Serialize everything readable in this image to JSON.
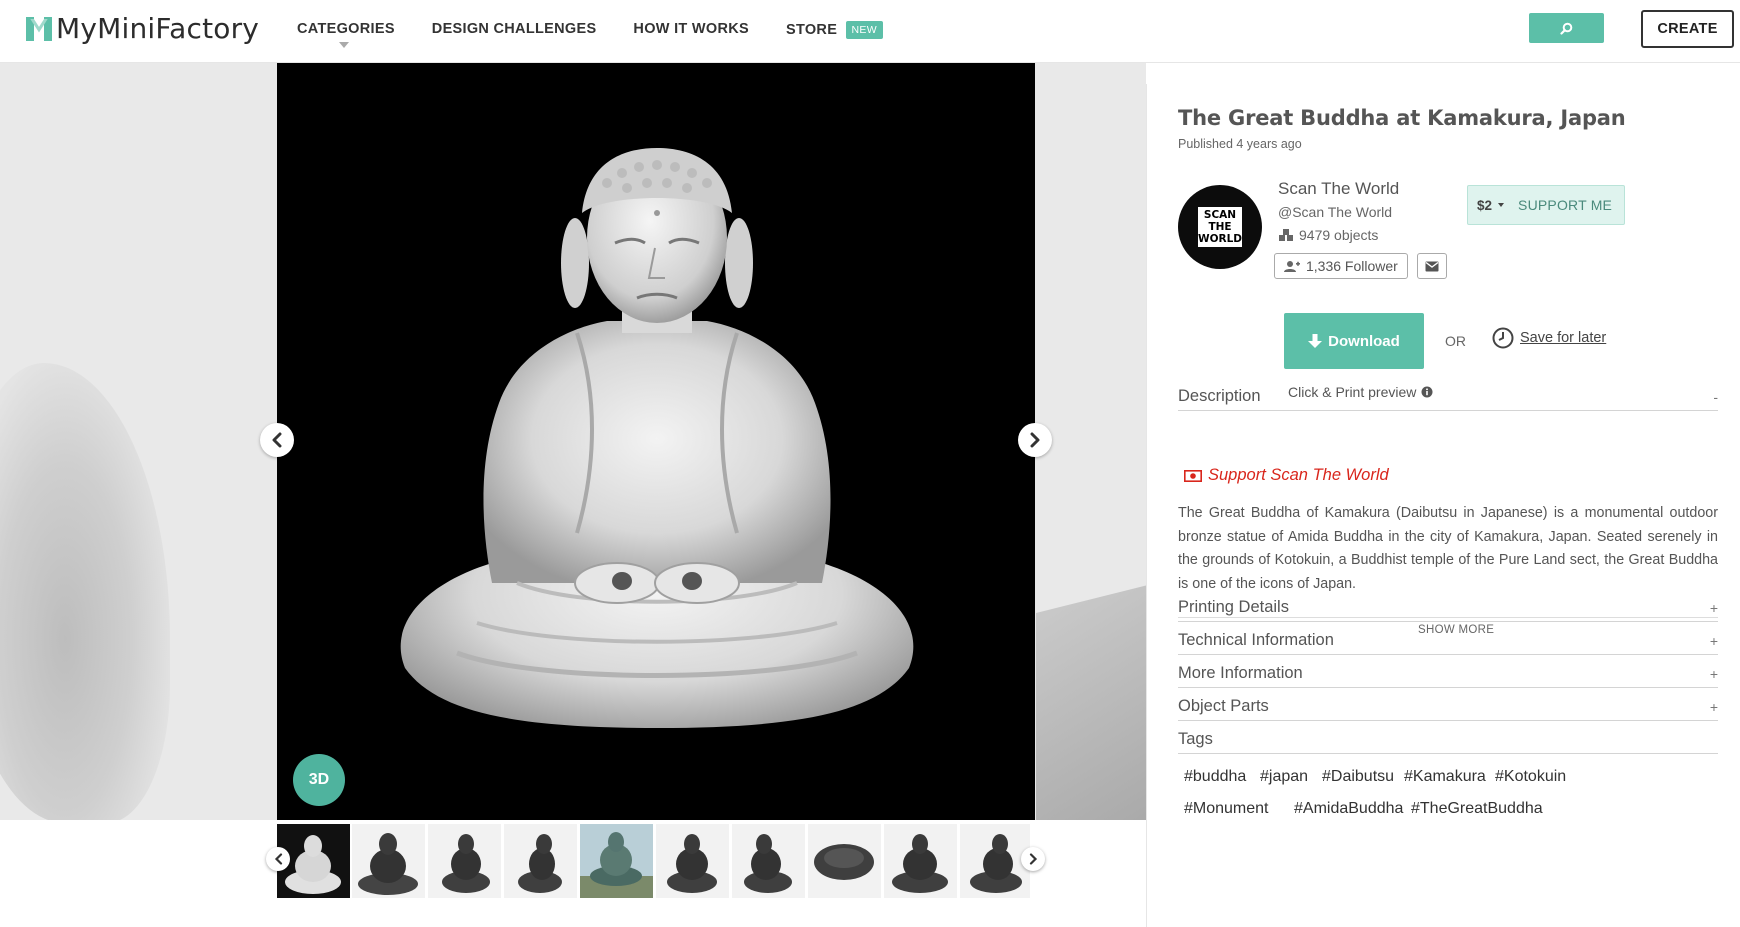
{
  "header": {
    "logo_text": "MyMiniFactory",
    "nav": [
      "CATEGORIES",
      "DESIGN CHALLENGES",
      "HOW IT WORKS",
      "STORE"
    ],
    "store_badge": "NEW",
    "search_icon": "search-icon",
    "create_label": "CREATE"
  },
  "gallery": {
    "view_3d_label": "3D",
    "thumbnail_count": 10
  },
  "object": {
    "title": "The Great Buddha at Kamakura, Japan",
    "published": "Published 4 years ago"
  },
  "creator": {
    "avatar_text": "SCAN THE WORLD",
    "name": "Scan The World",
    "handle": "@Scan The World",
    "objects": "9479 objects",
    "followers": "1,336 Follower"
  },
  "support": {
    "amount": "$2",
    "label": "SUPPORT ME"
  },
  "actions": {
    "download_label": "Download",
    "or_label": "OR",
    "save_label": "Save for later",
    "click_print_label": "Click & Print preview"
  },
  "description": {
    "heading": "Description",
    "toggle": "-",
    "support_link": "Support Scan The World",
    "text": "The Great Buddha of Kamakura (Daibutsu in Japanese) is a monumental outdoor bronze statue of Amida Buddha in the city of Kamakura, Japan. Seated serenely in the grounds of Kotokuin, a Buddhist temple of the Pure Land sect, the Great Buddha is one of the icons of Japan.",
    "show_more": "SHOW MORE"
  },
  "sections": [
    {
      "label": "Printing Details",
      "toggle": "+"
    },
    {
      "label": "Technical Information",
      "toggle": "+"
    },
    {
      "label": "More Information",
      "toggle": "+"
    },
    {
      "label": "Object Parts",
      "toggle": "+"
    },
    {
      "label": "Tags",
      "toggle": ""
    }
  ],
  "tags": [
    "#buddha",
    "#japan",
    "#Daibutsu",
    "#Kamakura",
    "#Kotokuin",
    "#Monument",
    "#AmidaBuddha",
    "#TheGreatBuddha"
  ],
  "colors": {
    "accent": "#5cbfa8",
    "support_link": "#d9261c",
    "viewer_bg": "#000000"
  }
}
